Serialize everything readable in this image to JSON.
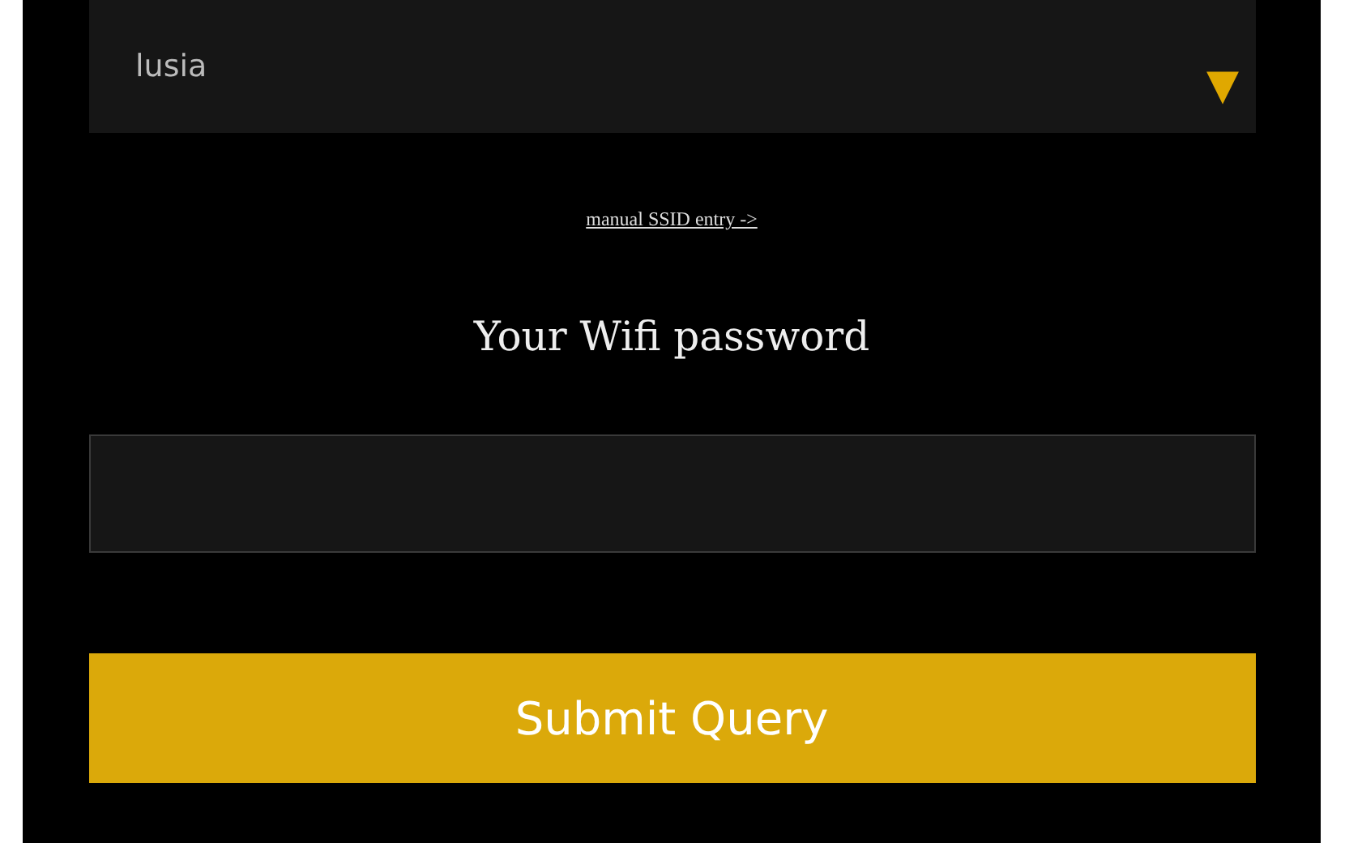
{
  "network_select": {
    "value": "lusia",
    "arrow": "▼"
  },
  "manual_link": "manual SSID entry ->",
  "password_label": "Your Wifi password",
  "submit_button": "Submit Query"
}
